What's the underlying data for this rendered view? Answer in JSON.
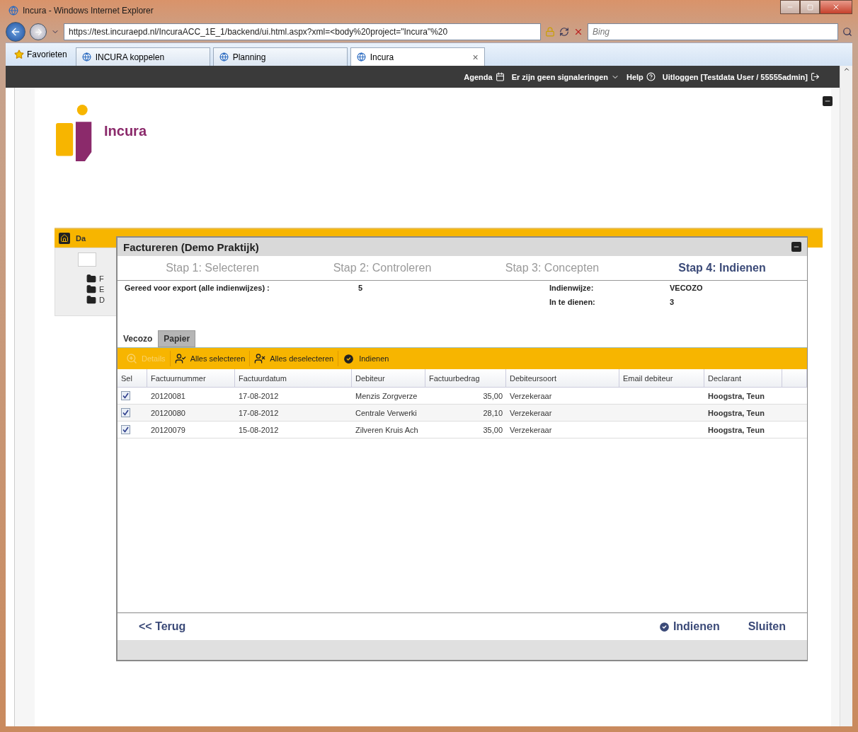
{
  "window": {
    "title": "Incura - Windows Internet Explorer"
  },
  "address_bar": {
    "url": "https://test.incuraepd.nl/IncuraACC_1E_1/backend/ui.html.aspx?xml=<body%20project=\"Incura\"%20"
  },
  "search": {
    "placeholder": "Bing"
  },
  "favorites": {
    "label": "Favorieten"
  },
  "browser_tabs": [
    {
      "label": "INCURA koppelen",
      "selected": false
    },
    {
      "label": "Planning",
      "selected": false
    },
    {
      "label": "Incura",
      "selected": true,
      "close": "×"
    }
  ],
  "top_bar": {
    "agenda": "Agenda",
    "signals": "Er zijn geen signaleringen",
    "help": "Help",
    "logout": "Uitloggen [Testdata User / 55555admin]"
  },
  "logo": {
    "text": "Incura"
  },
  "background_page": {
    "breadcrumb": "Da",
    "folders": [
      "F",
      "E",
      "D"
    ]
  },
  "dialog": {
    "title": "Factureren (Demo Praktijk)",
    "steps": [
      {
        "label": "Stap 1: Selecteren",
        "selected": false
      },
      {
        "label": "Stap 2: Controleren",
        "selected": false
      },
      {
        "label": "Stap 3: Concepten",
        "selected": false
      },
      {
        "label": "Stap 4: Indienen",
        "selected": true
      }
    ],
    "ready_label": "Gereed voor export (alle indienwijzes) :",
    "ready_value": "5",
    "method_label": "Indienwijze:",
    "method_value": "VECOZO",
    "submit_count_label": "In te dienen:",
    "submit_count_value": "3",
    "tabs": [
      {
        "label": "Vecozo",
        "selected": true
      },
      {
        "label": "Papier",
        "selected": false
      }
    ],
    "toolbar": [
      {
        "label": "Details",
        "kind": "details",
        "disabled": true
      },
      {
        "label": "Alles selecteren",
        "kind": "select",
        "disabled": false
      },
      {
        "label": "Alles deselecteren",
        "kind": "deselect",
        "disabled": false
      },
      {
        "label": "Indienen",
        "kind": "submit",
        "disabled": false
      }
    ],
    "table": {
      "columns": [
        "Sel",
        "Factuurnummer",
        "Factuurdatum",
        "Debiteur",
        "Factuurbedrag",
        "Debiteursoort",
        "Email debiteur",
        "Declarant"
      ],
      "rows": [
        {
          "checked": true,
          "number": "20120081",
          "date": "17-08-2012",
          "debtor": "Menzis Zorgverze",
          "amount": "35,00",
          "debtor_type": "Verzekeraar",
          "declarant": "Hoogstra, Teun"
        },
        {
          "checked": true,
          "number": "20120080",
          "date": "17-08-2012",
          "debtor": "Centrale Verwerki",
          "amount": "28,10",
          "debtor_type": "Verzekeraar",
          "declarant": "Hoogstra, Teun"
        },
        {
          "checked": true,
          "number": "20120079",
          "date": "15-08-2012",
          "debtor": "Zilveren Kruis Ach",
          "amount": "35,00",
          "debtor_type": "Verzekeraar",
          "declarant": "Hoogstra, Teun"
        }
      ]
    },
    "footer": {
      "back": "<< Terug",
      "submit": "Indienen",
      "close": "Sluiten"
    }
  }
}
